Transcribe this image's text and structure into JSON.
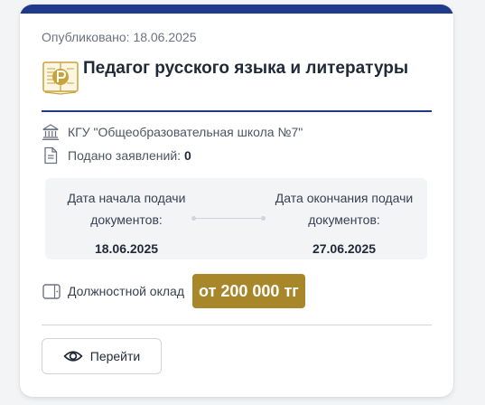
{
  "card": {
    "published": "Опубликовано: 18.06.2025",
    "title": "Педагог русского языка и литературы",
    "organization": "КГУ \"Общеобразовательная школа №7\"",
    "applications_label": "Подано заявлений:",
    "applications_count": "0",
    "dates": {
      "start_label": "Дата начала подачи документов:",
      "start_value": "18.06.2025",
      "end_label": "Дата окончания подачи документов:",
      "end_value": "27.06.2025"
    },
    "salary_label": "Должностной оклад",
    "salary_value": "от 200 000 тг",
    "go_label": "Перейти"
  },
  "icons": {
    "title": "book-logo-icon",
    "organization": "bank-building-icon",
    "applications": "document-icon",
    "salary": "wallet-icon",
    "go": "eye-icon"
  },
  "colors": {
    "accent": "#1f3a8a",
    "badge": "#a8862a",
    "logo": "#c9a23c"
  }
}
